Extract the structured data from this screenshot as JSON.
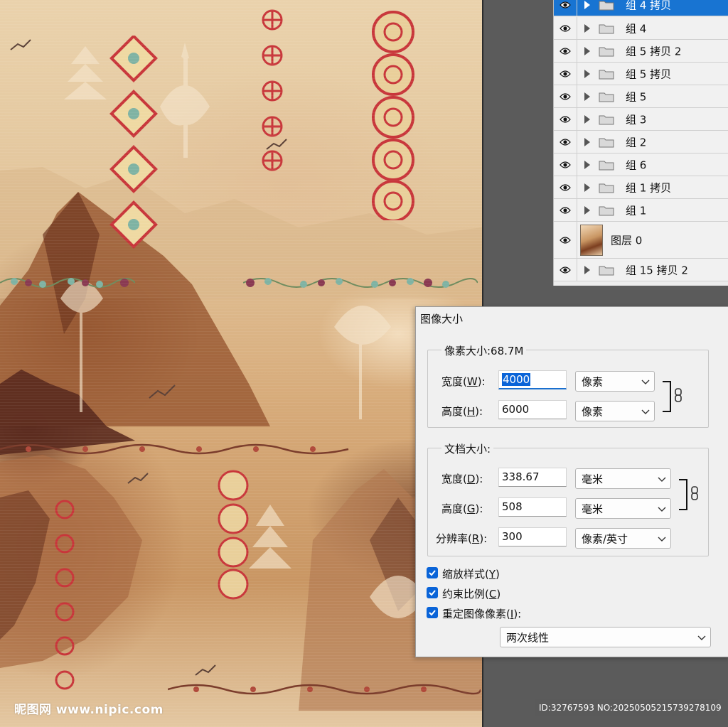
{
  "layers_panel": {
    "layers": [
      {
        "name": "组 4 拷贝",
        "type": "group",
        "selected": true
      },
      {
        "name": "组 4",
        "type": "group",
        "selected": false
      },
      {
        "name": "组 5 拷贝 2",
        "type": "group",
        "selected": false
      },
      {
        "name": "组 5 拷贝",
        "type": "group",
        "selected": false
      },
      {
        "name": "组 5",
        "type": "group",
        "selected": false
      },
      {
        "name": "组 3",
        "type": "group",
        "selected": false
      },
      {
        "name": "组 2",
        "type": "group",
        "selected": false
      },
      {
        "name": "组 6",
        "type": "group",
        "selected": false
      },
      {
        "name": "组 1 拷贝",
        "type": "group",
        "selected": false
      },
      {
        "name": "组 1",
        "type": "group",
        "selected": false
      },
      {
        "name": "图层 0",
        "type": "image",
        "selected": false
      },
      {
        "name": "组 15 拷贝 2",
        "type": "group",
        "selected": false
      }
    ]
  },
  "dialog": {
    "title": "图像大小",
    "pixel_dimensions": {
      "legend": "像素大小:68.7M",
      "width": {
        "label": "宽度",
        "key": "W",
        "value": "4000",
        "unit": "像素"
      },
      "height": {
        "label": "高度",
        "key": "H",
        "value": "6000",
        "unit": "像素"
      }
    },
    "document_size": {
      "legend": "文档大小:",
      "width": {
        "label": "宽度",
        "key": "D",
        "value": "338.67",
        "unit": "毫米"
      },
      "height": {
        "label": "高度",
        "key": "G",
        "value": "508",
        "unit": "毫米"
      },
      "resolution": {
        "label": "分辨率",
        "key": "R",
        "value": "300",
        "unit": "像素/英寸"
      }
    },
    "options": {
      "scale_styles": {
        "label": "缩放样式",
        "key": "Y",
        "checked": true
      },
      "constrain_proportions": {
        "label": "约束比例",
        "key": "C",
        "checked": true
      },
      "resample": {
        "label": "重定图像像素",
        "key": "I",
        "checked": true,
        "suffix": ":"
      }
    },
    "resample_method": "两次线性"
  },
  "watermarks": {
    "left": "昵图网 www.nipic.com",
    "right": "ID:32767593 NO:20250505215739278109"
  },
  "colors": {
    "selection_blue": "#1874d2",
    "checkbox_blue": "#0a64d8",
    "panel_bg": "#f0f0f0",
    "workspace_gray": "#5b5b5b"
  }
}
